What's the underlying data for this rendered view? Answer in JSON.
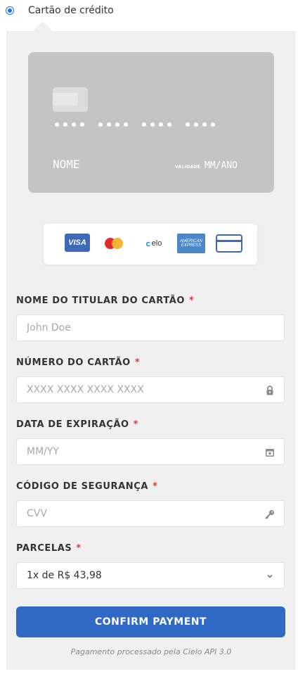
{
  "payment_method": {
    "label": "Cartão de crédito",
    "selected": true
  },
  "card_preview": {
    "digit_groups": [
      "••••",
      "••••",
      "••••",
      "••••"
    ],
    "name": "NOME",
    "valid_label": "VALIDADE",
    "valid_value": "MM/ANO"
  },
  "brands": {
    "visa": "VISA",
    "elo": "elo",
    "amex_top": "AMERICAN",
    "amex_bottom": "EXPRESS"
  },
  "fields": {
    "holder": {
      "label": "NOME DO TITULAR DO CARTÃO",
      "required": "*",
      "placeholder": "John Doe"
    },
    "number": {
      "label": "NÚMERO DO CARTÃO",
      "required": "*",
      "placeholder": "XXXX XXXX XXXX XXXX",
      "icon": "lock-icon"
    },
    "expiry": {
      "label": "DATA DE EXPIRAÇÃO",
      "required": "*",
      "placeholder": "MM/YY",
      "icon": "calendar-icon"
    },
    "cvv": {
      "label": "CÓDIGO DE SEGURANÇA",
      "required": "*",
      "placeholder": "CVV",
      "icon": "key-icon"
    },
    "installments": {
      "label": "PARCELAS",
      "required": "*",
      "value": "1x de R$ 43,98",
      "icon": "chevron-down-icon"
    }
  },
  "confirm_label": "CONFIRM PAYMENT",
  "footnote": "Pagamento processado pela Cielo API 3.0",
  "colors": {
    "accent": "#2f69c4",
    "panel": "#f0f0f0",
    "card": "#c4c4c4",
    "required": "#e03a3a"
  }
}
